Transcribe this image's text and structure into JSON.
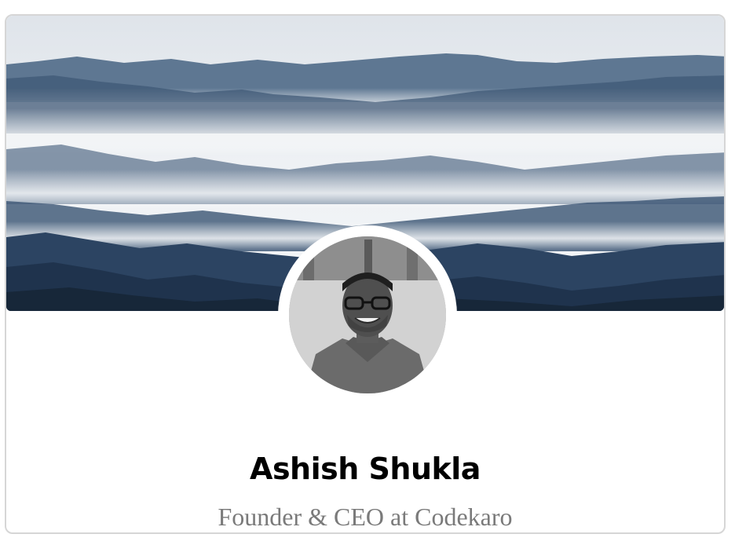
{
  "profile": {
    "name": "Ashish Shukla",
    "subtitle": "Founder & CEO at Codekaro"
  },
  "images": {
    "cover": "mountain-landscape-cover-photo",
    "avatar": "profile-photo"
  },
  "colors": {
    "name": "#000000",
    "subtitle": "#7a7a7a",
    "card_border": "#d6d6d6"
  }
}
